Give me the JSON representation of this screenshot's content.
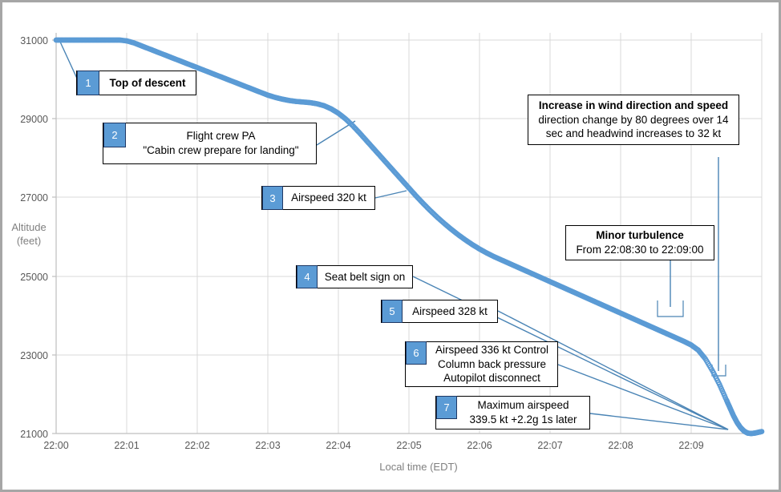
{
  "chart_data": {
    "type": "line",
    "title": "",
    "xlabel": "Local time  (EDT)",
    "ylabel": "Altitude\n(feet)",
    "ylabel_line1": "Altitude",
    "ylabel_line2": "(feet)",
    "x_tick_labels": [
      "22:00",
      "22:01",
      "22:02",
      "22:03",
      "22:04",
      "22:05",
      "22:06",
      "22:07",
      "22:08",
      "22:09"
    ],
    "y_tick_labels": [
      "21000",
      "23000",
      "25000",
      "27000",
      "29000",
      "31000"
    ],
    "y_ticks": [
      21000,
      23000,
      25000,
      27000,
      29000,
      31000
    ],
    "ylim": [
      21000,
      31000
    ],
    "xlim_minutes": [
      0,
      10
    ],
    "grid": true,
    "legend": "none",
    "series": [
      {
        "name": "Altitude",
        "marker": "open-circle",
        "color": "#5B9BD5",
        "x_minutes": [
          0.0,
          0.1,
          0.2,
          0.3,
          0.4,
          0.5,
          0.6,
          0.7,
          0.8,
          0.9,
          1.0,
          1.1,
          1.2,
          1.3,
          1.4,
          1.5,
          1.6,
          1.7,
          1.8,
          1.9,
          2.0,
          2.1,
          2.2,
          2.3,
          2.4,
          2.5,
          2.6,
          2.7,
          2.8,
          2.9,
          3.0,
          3.1,
          3.2,
          3.3,
          3.4,
          3.5,
          3.6,
          3.7,
          3.8,
          3.9,
          4.0,
          4.1,
          4.2,
          4.3,
          4.4,
          4.5,
          4.6,
          4.7,
          4.8,
          4.9,
          5.0,
          5.1,
          5.2,
          5.3,
          5.4,
          5.5,
          5.6,
          5.7,
          5.8,
          5.9,
          6.0,
          6.1,
          6.2,
          6.3,
          6.4,
          6.5,
          6.6,
          6.7,
          6.8,
          6.9,
          7.0,
          7.1,
          7.2,
          7.3,
          7.4,
          7.5,
          7.6,
          7.7,
          7.8,
          7.9,
          8.0,
          8.1,
          8.2,
          8.3,
          8.4,
          8.5,
          8.6,
          8.7,
          8.8,
          8.9,
          9.0,
          9.1,
          9.2,
          9.3,
          9.4,
          9.5,
          9.55,
          9.6,
          9.65,
          9.7,
          9.75,
          9.8,
          9.85,
          9.9,
          9.95,
          10.0
        ],
        "y_feet": [
          31000,
          31000,
          31000,
          31000,
          31000,
          31000,
          31000,
          31000,
          31000,
          31000,
          30980,
          30930,
          30860,
          30790,
          30720,
          30650,
          30580,
          30510,
          30440,
          30370,
          30300,
          30230,
          30160,
          30090,
          30020,
          29950,
          29880,
          29810,
          29740,
          29670,
          29600,
          29545,
          29500,
          29465,
          29440,
          29425,
          29410,
          29380,
          29330,
          29250,
          29140,
          29000,
          28830,
          28640,
          28440,
          28240,
          28040,
          27840,
          27640,
          27440,
          27240,
          27040,
          26850,
          26670,
          26500,
          26340,
          26190,
          26050,
          25920,
          25800,
          25690,
          25590,
          25500,
          25420,
          25340,
          25260,
          25180,
          25100,
          25020,
          24940,
          24860,
          24780,
          24700,
          24620,
          24540,
          24460,
          24380,
          24300,
          24220,
          24140,
          24060,
          23980,
          23900,
          23820,
          23740,
          23660,
          23580,
          23500,
          23420,
          23340,
          23250,
          23120,
          22900,
          22600,
          22250,
          21850,
          21650,
          21450,
          21280,
          21150,
          21060,
          21010,
          21000,
          21010,
          21030,
          21050
        ]
      }
    ],
    "annotations": [
      {
        "id": 1,
        "number": "1",
        "lines": [
          "Top of descent"
        ],
        "bold": [
          false
        ]
      },
      {
        "id": 2,
        "number": "2",
        "lines": [
          "Flight crew PA",
          "\"Cabin crew prepare for landing\""
        ],
        "bold": [
          false,
          false
        ]
      },
      {
        "id": 3,
        "number": "3",
        "lines": [
          "Airspeed 320 kt"
        ],
        "bold": [
          false
        ]
      },
      {
        "id": 4,
        "number": "4",
        "lines": [
          "Seat belt sign on"
        ],
        "bold": [
          false
        ]
      },
      {
        "id": 5,
        "number": "5",
        "lines": [
          "Airspeed 328 kt"
        ],
        "bold": [
          false
        ]
      },
      {
        "id": 6,
        "number": "6",
        "lines": [
          "Airspeed 336 kt Control",
          "Column back pressure",
          "Autopilot disconnect"
        ],
        "bold": [
          false,
          false,
          false
        ]
      },
      {
        "id": 7,
        "number": "7",
        "lines": [
          "Maximum airspeed",
          "339.5 kt +2.2g 1s later"
        ],
        "bold": [
          false,
          false
        ]
      },
      {
        "id": "wind",
        "number": "",
        "lines": [
          "Increase in wind direction and speed",
          "direction change by 80 degrees over 14",
          "sec and headwind increases to 32 kt"
        ],
        "bold": [
          true,
          false,
          false
        ]
      },
      {
        "id": "turbulence",
        "number": "",
        "lines": [
          "Minor turbulence",
          "From 22:08:30 to 22:09:00"
        ],
        "bold": [
          true,
          false
        ]
      }
    ],
    "colors": {
      "series": "#5B9BD5",
      "badge_fill": "#5B9BD5",
      "badge_border": "#1F3864",
      "leader_line": "#4A84B5",
      "gridline": "#D9D9D9",
      "axis_line": "#BFBFBF",
      "tick_text": "#595959",
      "axis_title_text": "#808080",
      "frame": "#A6A6A6",
      "callout_border": "#000000",
      "background": "#FFFFFF"
    }
  },
  "callouts": {
    "c1": {
      "line1": "Top of descent",
      "num": "1"
    },
    "c2": {
      "line1": "Flight crew PA",
      "line2": "\"Cabin crew prepare for landing\"",
      "num": "2"
    },
    "c3": {
      "line1": "Airspeed 320 kt",
      "num": "3"
    },
    "c4": {
      "line1": "Seat belt sign on",
      "num": "4"
    },
    "c5": {
      "line1": "Airspeed 328 kt",
      "num": "5"
    },
    "c6": {
      "line1": "Airspeed 336 kt Control",
      "line2": "Column back pressure",
      "line3": "Autopilot disconnect",
      "num": "6"
    },
    "c7": {
      "line1": "Maximum airspeed",
      "line2": "339.5 kt +2.2g 1s later",
      "num": "7"
    },
    "wind": {
      "line1": "Increase in wind direction and speed",
      "line2": "direction change by 80 degrees over 14",
      "line3": "sec and headwind increases to 32 kt"
    },
    "turbulence": {
      "line1": "Minor turbulence",
      "line2": "From 22:08:30 to 22:09:00"
    }
  },
  "axes": {
    "y_title_line1": "Altitude",
    "y_title_line2": "(feet)",
    "x_title": "Local time  (EDT)",
    "y0": "21000",
    "y1": "23000",
    "y2": "25000",
    "y3": "27000",
    "y4": "29000",
    "y5": "31000",
    "x0": "22:00",
    "x1": "22:01",
    "x2": "22:02",
    "x3": "22:03",
    "x4": "22:04",
    "x5": "22:05",
    "x6": "22:06",
    "x7": "22:07",
    "x8": "22:08",
    "x9": "22:09"
  }
}
